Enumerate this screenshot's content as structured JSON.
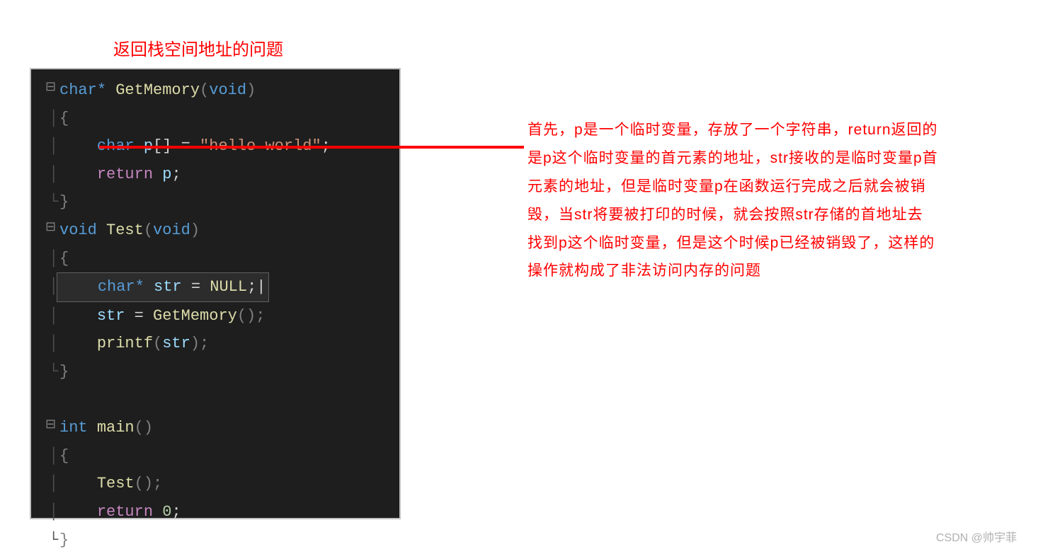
{
  "title": "返回栈空间地址的问题",
  "code": {
    "l1": {
      "kw": "char",
      "star": "*",
      "fn": " GetMemory",
      "paren_open": "(",
      "arg": "void",
      "paren_close": ")"
    },
    "l2": "{",
    "l3": {
      "indent": "    ",
      "kw": "char",
      "sp": " ",
      "var": "p",
      "brackets": "[] = ",
      "str": "\"hello world\"",
      "semi": ";"
    },
    "l4": {
      "indent": "    ",
      "kw": "return",
      "sp": " ",
      "var": "p",
      "semi": ";"
    },
    "l5": "}",
    "l6": {
      "kw": "void",
      "sp": " ",
      "fn": "Test",
      "paren_open": "(",
      "arg": "void",
      "paren_close": ")"
    },
    "l7": "{",
    "l8": {
      "indent": "    ",
      "kw": "char",
      "star": "*",
      "sp": " ",
      "var": "str",
      "eq": " = ",
      "null": "NULL",
      "semi": ";"
    },
    "l9": {
      "indent": "    ",
      "var": "str",
      "eq": " = ",
      "fn": "GetMemory",
      "parens": "();"
    },
    "l10": {
      "indent": "    ",
      "fn": "printf",
      "paren_open": "(",
      "var": "str",
      "paren_close": ");"
    },
    "l11": "}",
    "l12": "",
    "l13": {
      "kw": "int",
      "sp": " ",
      "fn": "main",
      "parens": "()"
    },
    "l14": "{",
    "l15": {
      "indent": "    ",
      "fn": "Test",
      "parens": "();"
    },
    "l16": {
      "indent": "    ",
      "kw": "return",
      "sp": " ",
      "num": "0",
      "semi": ";"
    },
    "l17": "}"
  },
  "explanation": "首先，p是一个临时变量，存放了一个字符串，return返回的是p这个临时变量的首元素的地址，str接收的是临时变量p首元素的地址，但是临时变量p在函数运行完成之后就会被销毁，当str将要被打印的时候，就会按照str存储的首地址去找到p这个临时变量，但是这个时候p已经被销毁了，这样的操作就构成了非法访问内存的问题",
  "watermark": "CSDN @帅宇菲"
}
